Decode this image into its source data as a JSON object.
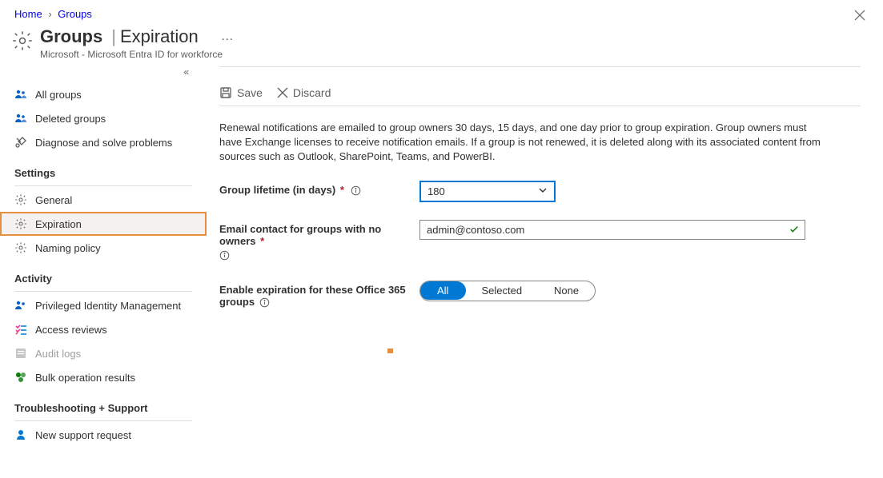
{
  "breadcrumb": {
    "home": "Home",
    "groups": "Groups"
  },
  "header": {
    "title_strong": "Groups",
    "title_sub": "Expiration",
    "subtitle": "Microsoft - Microsoft Entra ID for workforce"
  },
  "toolbar": {
    "save": "Save",
    "discard": "Discard"
  },
  "sidebar": {
    "nav": {
      "all_groups": "All groups",
      "deleted_groups": "Deleted groups",
      "diagnose": "Diagnose and solve problems"
    },
    "sections": {
      "settings": "Settings",
      "activity": "Activity",
      "troubleshooting": "Troubleshooting + Support"
    },
    "settings": {
      "general": "General",
      "expiration": "Expiration",
      "naming_policy": "Naming policy"
    },
    "activity": {
      "pim": "Privileged Identity Management",
      "access_reviews": "Access reviews",
      "audit_logs": "Audit logs",
      "bulk_results": "Bulk operation results"
    },
    "troubleshooting": {
      "support_request": "New support request"
    }
  },
  "main": {
    "info_text": "Renewal notifications are emailed to group owners 30 days, 15 days, and one day prior to group expiration. Group owners must have Exchange licenses to receive notification emails. If a group is not renewed, it is deleted along with its associated content from sources such as Outlook, SharePoint, Teams, and PowerBI.",
    "lifetime_label": "Group lifetime (in days)",
    "lifetime_value": "180",
    "email_label": "Email contact for groups with no owners",
    "email_value": "admin@contoso.com",
    "enable_label": "Enable expiration for these Office 365 groups",
    "seg_all": "All",
    "seg_selected": "Selected",
    "seg_none": "None"
  }
}
